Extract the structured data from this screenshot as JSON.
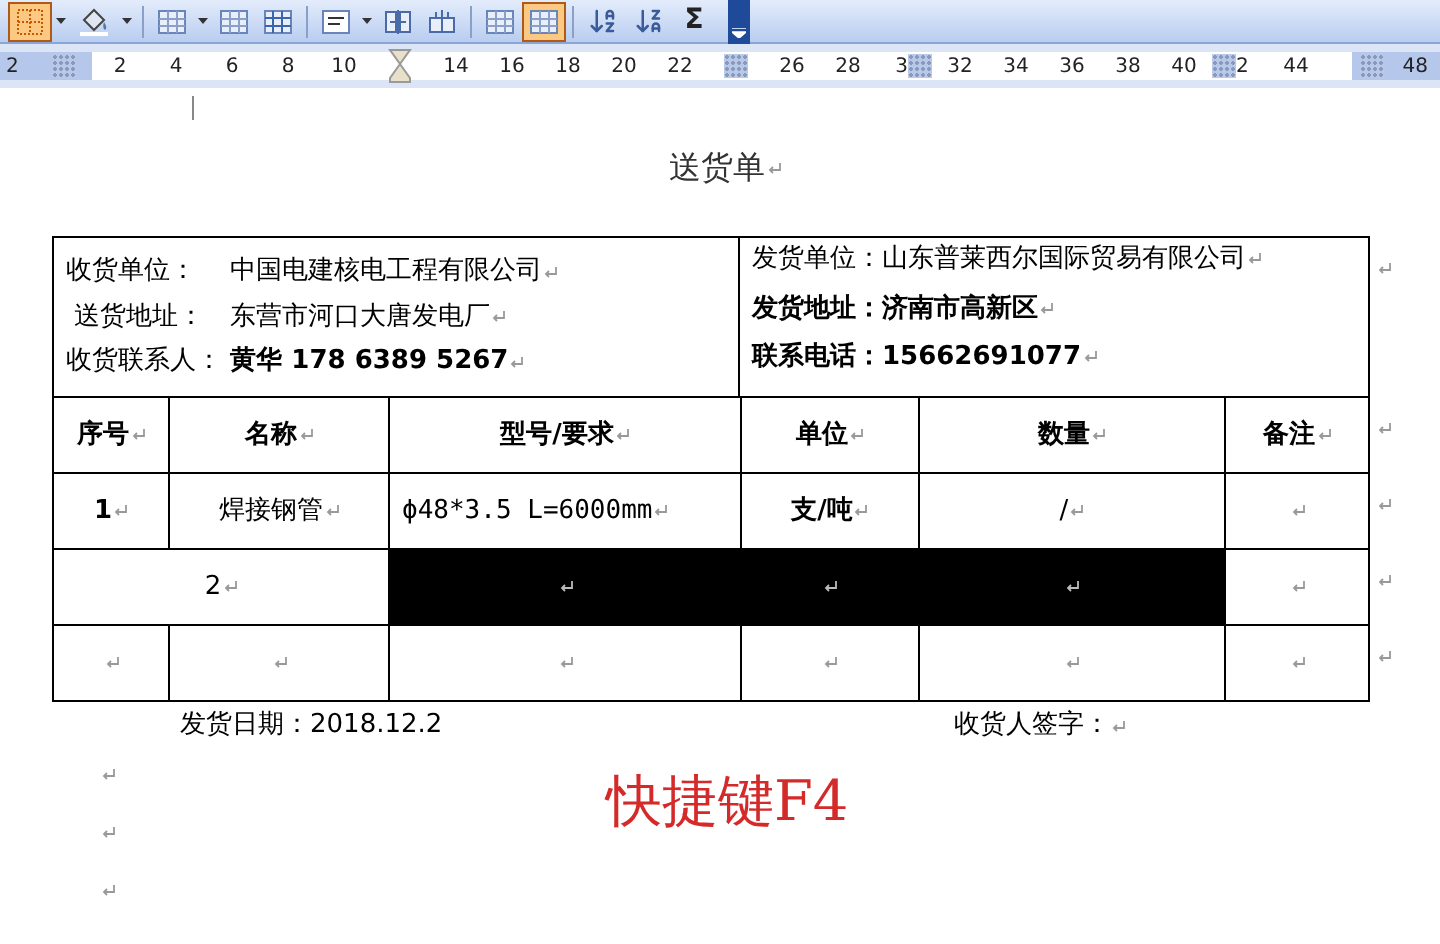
{
  "toolbar": {
    "groups": [
      [
        {
          "kind": "borders",
          "menu": true,
          "selected": true
        },
        {
          "kind": "shading",
          "menu": true,
          "selected": false
        }
      ],
      [
        {
          "kind": "insert-table",
          "menu": true,
          "selected": false
        },
        {
          "kind": "merge",
          "menu": false,
          "selected": false
        },
        {
          "kind": "split",
          "menu": false,
          "selected": false
        }
      ],
      [
        {
          "kind": "align",
          "menu": true,
          "selected": false
        },
        {
          "kind": "distribute-rows",
          "menu": false,
          "selected": false
        },
        {
          "kind": "distribute-columns",
          "menu": false,
          "selected": false
        }
      ],
      [
        {
          "kind": "autoformat",
          "menu": false,
          "selected": false
        },
        {
          "kind": "gridlines",
          "menu": false,
          "selected": true
        }
      ],
      [
        {
          "kind": "sort-asc",
          "menu": false,
          "selected": false
        },
        {
          "kind": "sort-desc",
          "menu": false,
          "selected": false
        },
        {
          "kind": "sum",
          "label": "Σ",
          "menu": false,
          "selected": false
        }
      ]
    ]
  },
  "ruler": {
    "left_margin": [
      {
        "kind": "label",
        "text": "2"
      },
      {
        "kind": "marker"
      }
    ],
    "items": [
      {
        "kind": "label",
        "text": "2"
      },
      {
        "kind": "label",
        "text": "4"
      },
      {
        "kind": "label",
        "text": "6"
      },
      {
        "kind": "label",
        "text": "8"
      },
      {
        "kind": "label",
        "text": "10"
      },
      {
        "kind": "indent"
      },
      {
        "kind": "label",
        "text": "14"
      },
      {
        "kind": "label",
        "text": "16"
      },
      {
        "kind": "label",
        "text": "18"
      },
      {
        "kind": "label",
        "text": "20"
      },
      {
        "kind": "label",
        "text": "22"
      },
      {
        "kind": "marker"
      },
      {
        "kind": "label",
        "text": "26"
      },
      {
        "kind": "label",
        "text": "28"
      },
      {
        "kind": "partial",
        "text": "3"
      },
      {
        "kind": "label",
        "text": "32"
      },
      {
        "kind": "label",
        "text": "34"
      },
      {
        "kind": "label",
        "text": "36"
      },
      {
        "kind": "label",
        "text": "38"
      },
      {
        "kind": "label",
        "text": "40"
      },
      {
        "kind": "partial-right",
        "text": "2"
      },
      {
        "kind": "label",
        "text": "44"
      }
    ],
    "right_margin": [
      {
        "kind": "marker"
      },
      {
        "kind": "label",
        "text": "48"
      }
    ]
  },
  "document": {
    "title": "送货单",
    "info": {
      "left": [
        "收货单位：　 中国电建核电工程有限公司",
        " 送货地址：　东营市河口大唐发电厂",
        "收货联系人： **黄华 178 6389 5267**"
      ],
      "right": [
        "发货单位：山东普莱西尔国际贸易有限公司",
        "**发货地址：济南市高新区**",
        "**联系电话：15662691077**"
      ]
    },
    "table": {
      "columns": [
        "序号",
        "名称",
        "型号/要求",
        "单位",
        "数量",
        "备注"
      ],
      "rows": [
        [
          {
            "kind": "plain",
            "text": "1",
            "bold": true,
            "selected": false
          },
          {
            "kind": "plain",
            "text": "焊接钢管",
            "bold": false,
            "selected": false
          },
          {
            "kind": "mono",
            "text": "ϕ48*3.5 L=6000mm",
            "bold": false,
            "selected": false
          },
          {
            "kind": "plain",
            "text": "支/吨",
            "bold": true,
            "selected": false
          },
          {
            "kind": "plain",
            "text": "/",
            "bold": false,
            "selected": false
          },
          {
            "kind": "plain",
            "selected": false
          }
        ],
        [
          {
            "kind": "merged",
            "text": "2",
            "bold": false,
            "selected": false
          },
          {
            "kind": "plain",
            "selected": true
          },
          {
            "kind": "plain",
            "selected": true
          },
          {
            "kind": "plain",
            "selected": true
          },
          {
            "kind": "plain",
            "selected": false
          }
        ],
        [
          {
            "kind": "plain",
            "selected": false
          },
          {
            "kind": "plain",
            "selected": false
          },
          {
            "kind": "plain",
            "selected": false
          },
          {
            "kind": "plain",
            "selected": false
          },
          {
            "kind": "plain",
            "selected": false
          },
          {
            "kind": "plain",
            "selected": false
          }
        ]
      ]
    },
    "ship_date": "发货日期：2018.12.2",
    "signature": "收货人签字：",
    "caption": "快捷键F4"
  }
}
